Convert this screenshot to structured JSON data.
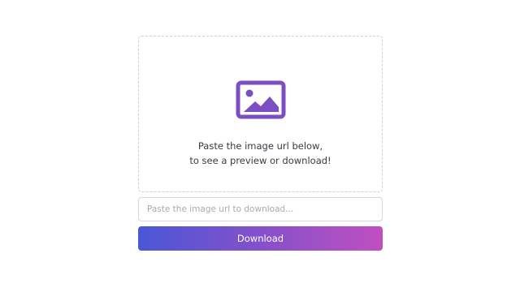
{
  "preview": {
    "icon": "image-icon",
    "line1": "Paste the image url below,",
    "line2": "to see a preview or download!"
  },
  "input": {
    "placeholder": "Paste the image url to download...",
    "value": ""
  },
  "download": {
    "label": "Download"
  },
  "colors": {
    "accent": "#7b4fc3",
    "gradient_start": "#4a56d6",
    "gradient_end": "#c04fc0",
    "border": "#cfcfd6"
  }
}
